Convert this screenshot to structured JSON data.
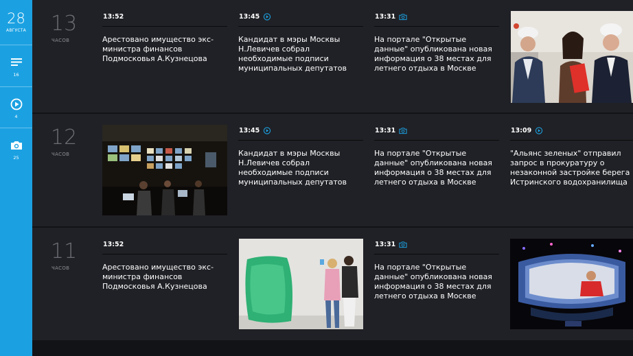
{
  "sidebar": {
    "day": "28",
    "month": "АВГУСТА",
    "news_count": "16",
    "video_count": "4",
    "photo_count": "25"
  },
  "rows": [
    {
      "hour": "13",
      "hour_label": "ЧАСОВ",
      "cards": [
        {
          "time": "13:52",
          "text": "Арестовано имущество экс-министра финансов Подмосковья А.Кузнецова"
        },
        {
          "time": "13:45",
          "icon": "play-icon",
          "text": "Кандидат в мэры Москвы Н.Левичев собрал необходимые подписи муниципальных депутатов"
        },
        {
          "time": "13:31",
          "icon": "camera-icon",
          "text": "На портале \"Открытые данные\" опубликована новая информация о 38 местах для летнего отдыха в Москве"
        }
      ]
    },
    {
      "hour": "12",
      "hour_label": "ЧАСОВ",
      "cards": [
        {
          "time": "13:45",
          "icon": "play-icon",
          "text": "Кандидат в мэры Москвы Н.Левичев собрал необходимые подписи муниципальных депутатов"
        },
        {
          "time": "13:31",
          "icon": "camera-icon",
          "text": "На портале \"Открытые данные\" опубликована новая информация о 38 местах для летнего отдыха в Москве"
        },
        {
          "time": "13:09",
          "icon": "play-icon",
          "text": "\"Альянс зеленых\" отправил запрос в прокуратуру о незаконной застройке берега Истринского водохранилища"
        }
      ]
    },
    {
      "hour": "11",
      "hour_label": "ЧАСОВ",
      "cards": [
        {
          "time": "13:52",
          "text": "Арестовано имущество экс-министра финансов Подмосковья А.Кузнецова"
        },
        {
          "time": "13:31",
          "icon": "camera-icon",
          "text": "На портале \"Открытые данные\" опубликована новая информация о 38 местах для летнего отдыха в Москве"
        }
      ]
    }
  ],
  "colors": {
    "accent": "#1ba1e2",
    "row_bg": "#202126",
    "page_bg": "#121316"
  }
}
